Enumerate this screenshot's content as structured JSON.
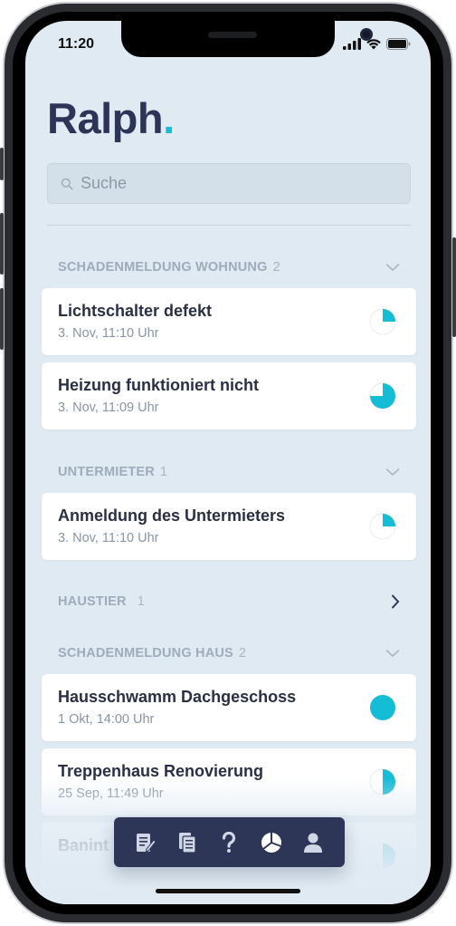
{
  "status_bar": {
    "time": "11:20"
  },
  "app": {
    "title": "Ralph",
    "title_dot": "."
  },
  "search": {
    "placeholder": "Suche"
  },
  "sections": [
    {
      "title": "SCHADENMELDUNG WOHNUNG",
      "count": "2",
      "expanded": true,
      "items": [
        {
          "title": "Lichtschalter defekt",
          "date": "3. Nov, 11:10 Uhr",
          "progress": 0.25
        },
        {
          "title": "Heizung funktioniert nicht",
          "date": "3. Nov, 11:09 Uhr",
          "progress": 0.75
        }
      ]
    },
    {
      "title": "UNTERMIETER",
      "count": "1",
      "expanded": true,
      "items": [
        {
          "title": "Anmeldung des Untermieters",
          "date": "3. Nov, 11:10 Uhr",
          "progress": 0.25
        }
      ]
    },
    {
      "title": "HAUSTIER",
      "count": "1",
      "expanded": false,
      "items": []
    },
    {
      "title": "SCHADENMELDUNG HAUS",
      "count": "2",
      "expanded": true,
      "items": [
        {
          "title": "Hausschwamm Dachgeschoss",
          "date": "1 Okt, 14:00 Uhr",
          "progress": 1.0
        },
        {
          "title": "Treppenhaus Renovierung",
          "date": "25 Sep, 11:49 Uhr",
          "progress": 0.5
        },
        {
          "title": "Banint",
          "date": "",
          "progress": 0.5
        }
      ]
    }
  ],
  "tab_bar": {
    "tabs": [
      {
        "icon": "edit-document-icon",
        "active": false
      },
      {
        "icon": "documents-icon",
        "active": false
      },
      {
        "icon": "help-icon",
        "active": false
      },
      {
        "icon": "pie-chart-icon",
        "active": true
      },
      {
        "icon": "user-icon",
        "active": false
      }
    ]
  },
  "colors": {
    "accent": "#14bcd6",
    "navy": "#2c3558",
    "background": "#dfeaf3"
  }
}
